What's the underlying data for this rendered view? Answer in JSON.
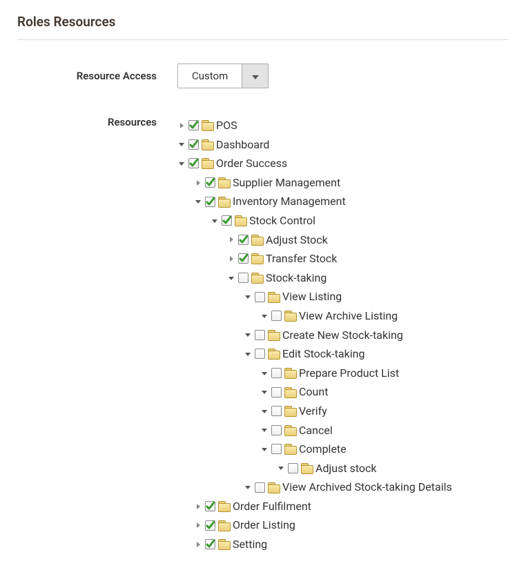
{
  "title": "Roles Resources",
  "resourceAccess": {
    "label": "Resource Access",
    "value": "Custom"
  },
  "resourcesLabel": "Resources",
  "tree": [
    {
      "id": "pos",
      "label": "POS",
      "checked": true,
      "expand": "collapsed",
      "children": []
    },
    {
      "id": "dashboard",
      "label": "Dashboard",
      "checked": true,
      "expand": "expanded",
      "children": []
    },
    {
      "id": "order-success",
      "label": "Order Success",
      "checked": true,
      "expand": "expanded",
      "children": [
        {
          "id": "supplier-mgmt",
          "label": "Supplier Management",
          "checked": true,
          "expand": "collapsed",
          "children": []
        },
        {
          "id": "inventory-mgmt",
          "label": "Inventory Management",
          "checked": true,
          "expand": "expanded",
          "children": [
            {
              "id": "stock-control",
              "label": "Stock Control",
              "checked": true,
              "expand": "expanded",
              "children": [
                {
                  "id": "adjust-stock",
                  "label": "Adjust Stock",
                  "checked": true,
                  "expand": "collapsed",
                  "children": []
                },
                {
                  "id": "transfer-stock",
                  "label": "Transfer Stock",
                  "checked": true,
                  "expand": "collapsed",
                  "children": []
                },
                {
                  "id": "stock-taking",
                  "label": "Stock-taking",
                  "checked": false,
                  "expand": "expanded",
                  "children": [
                    {
                      "id": "view-listing",
                      "label": "View Listing",
                      "checked": false,
                      "expand": "expanded",
                      "children": [
                        {
                          "id": "view-archive-listing",
                          "label": "View Archive Listing",
                          "checked": false,
                          "expand": "expanded",
                          "children": []
                        }
                      ]
                    },
                    {
                      "id": "create-new-stocktaking",
                      "label": "Create New Stock-taking",
                      "checked": false,
                      "expand": "expanded",
                      "children": []
                    },
                    {
                      "id": "edit-stocktaking",
                      "label": "Edit Stock-taking",
                      "checked": false,
                      "expand": "expanded",
                      "children": [
                        {
                          "id": "prepare-product-list",
                          "label": "Prepare Product List",
                          "checked": false,
                          "expand": "expanded",
                          "children": []
                        },
                        {
                          "id": "count",
                          "label": "Count",
                          "checked": false,
                          "expand": "expanded",
                          "children": []
                        },
                        {
                          "id": "verify",
                          "label": "Verify",
                          "checked": false,
                          "expand": "expanded",
                          "children": []
                        },
                        {
                          "id": "cancel",
                          "label": "Cancel",
                          "checked": false,
                          "expand": "expanded",
                          "children": []
                        },
                        {
                          "id": "complete",
                          "label": "Complete",
                          "checked": false,
                          "expand": "expanded",
                          "children": [
                            {
                              "id": "adjust-stock-2",
                              "label": "Adjust stock",
                              "checked": false,
                              "expand": "expanded",
                              "children": []
                            }
                          ]
                        }
                      ]
                    },
                    {
                      "id": "view-archived-details",
                      "label": "View Archived Stock-taking Details",
                      "checked": false,
                      "expand": "expanded",
                      "children": []
                    }
                  ]
                }
              ]
            }
          ]
        },
        {
          "id": "order-fulfilment",
          "label": "Order Fulfilment",
          "checked": true,
          "expand": "collapsed",
          "children": []
        },
        {
          "id": "order-listing",
          "label": "Order Listing",
          "checked": true,
          "expand": "collapsed",
          "children": []
        },
        {
          "id": "setting",
          "label": "Setting",
          "checked": true,
          "expand": "collapsed",
          "children": []
        }
      ]
    }
  ]
}
